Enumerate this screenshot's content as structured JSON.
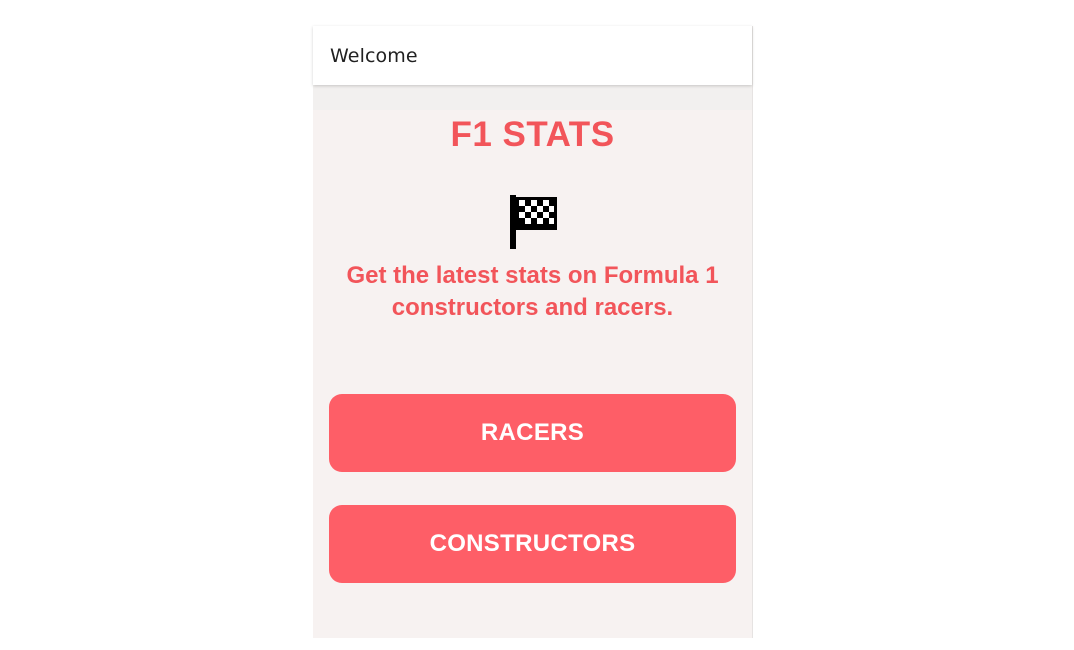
{
  "app_bar": {
    "title": "Welcome"
  },
  "main": {
    "title": "F1 STATS",
    "icon": "checkered-flag-icon",
    "tagline": "Get the latest stats on Formula 1 constructors and racers.",
    "buttons": {
      "racers_label": "RACERS",
      "constructors_label": "CONSTRUCTORS"
    }
  },
  "colors": {
    "accent": "#f2555a",
    "button": "#fe5e67",
    "background": "#f7f2f1",
    "app_bar": "#ffffff"
  }
}
